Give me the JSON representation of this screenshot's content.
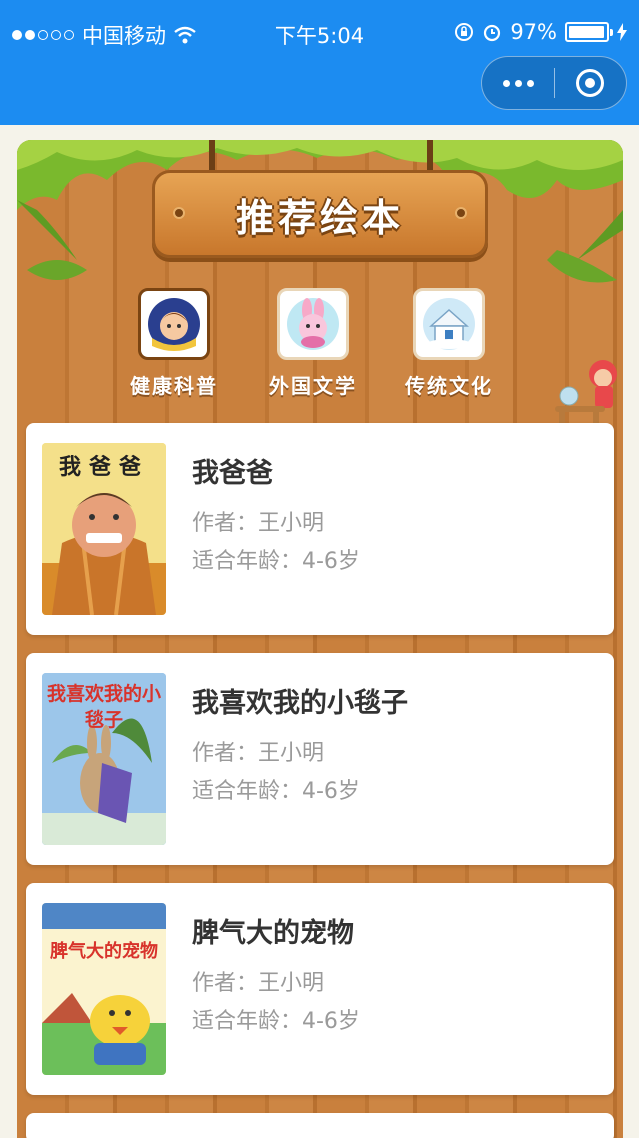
{
  "status_bar": {
    "carrier": "中国移动",
    "time": "下午5:04",
    "battery": "97%",
    "battery_level": 0.97
  },
  "header": {
    "more_icon": "more-dots-icon",
    "close_icon": "target-icon"
  },
  "banner": {
    "title": "推荐绘本"
  },
  "categories": [
    {
      "label": "健康科普",
      "active": true
    },
    {
      "label": "外国文学",
      "active": false
    },
    {
      "label": "传统文化",
      "active": false
    }
  ],
  "books": [
    {
      "title": "我爸爸",
      "author": "作者：王小明",
      "age": "适合年龄：4-6岁",
      "cover_text": "我爸爸"
    },
    {
      "title": "我喜欢我的小毯子",
      "author": "作者：王小明",
      "age": "适合年龄：4-6岁",
      "cover_text": "我喜欢我的小毯子"
    },
    {
      "title": "脾气大的宠物",
      "author": "作者：王小明",
      "age": "适合年龄：4-6岁",
      "cover_text": "脾气大的宠物"
    }
  ],
  "colors": {
    "nav": "#1c8cf1",
    "wood": "#c9803d",
    "title_text": "#333333",
    "meta_text": "#9a9a9a"
  }
}
